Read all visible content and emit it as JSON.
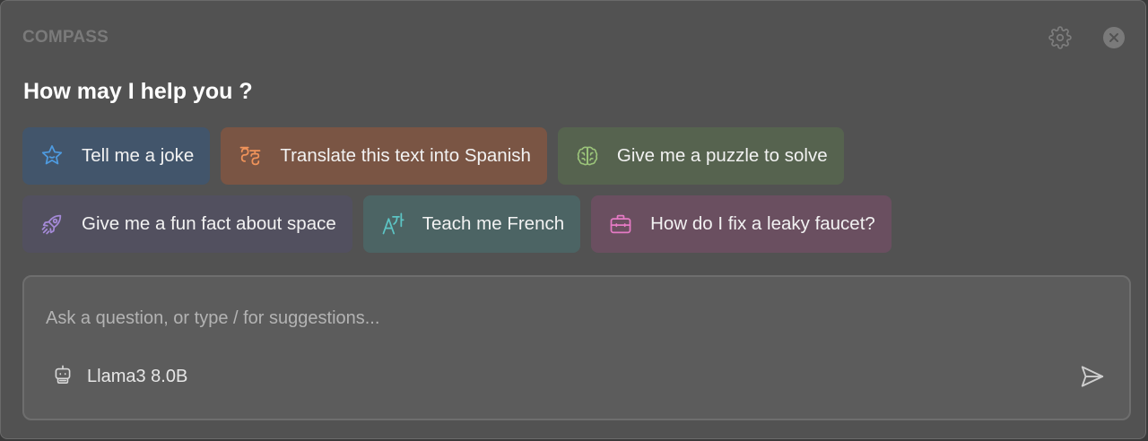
{
  "app": {
    "title": "COMPASS"
  },
  "header": {
    "heading": "How may I help you ?"
  },
  "suggestions": [
    {
      "label": "Tell me a joke",
      "icon": "star-icon",
      "bg": "#42556b",
      "icon_color": "#4e9be0"
    },
    {
      "label": "Translate this text into Spanish",
      "icon": "language-icon",
      "bg": "#7a5544",
      "icon_color": "#f0935a"
    },
    {
      "label": "Give me a puzzle to solve",
      "icon": "brain-icon",
      "bg": "#56634f",
      "icon_color": "#9bc47a"
    },
    {
      "label": "Give me a fun fact about space",
      "icon": "rocket-icon",
      "bg": "#52505f",
      "icon_color": "#a58ad8"
    },
    {
      "label": "Teach me French",
      "icon": "translate-icon",
      "bg": "#4c6464",
      "icon_color": "#5cc4c4"
    },
    {
      "label": "How do I fix a leaky faucet?",
      "icon": "briefcase-icon",
      "bg": "#6a4f60",
      "icon_color": "#e47ac4"
    }
  ],
  "composer": {
    "placeholder": "Ask a question, or type / for suggestions...",
    "value": "",
    "model": "Llama3 8.0B"
  },
  "colors": {
    "window_bg": "#525252",
    "heading": "#ffffff",
    "muted": "#7a7a7a"
  }
}
